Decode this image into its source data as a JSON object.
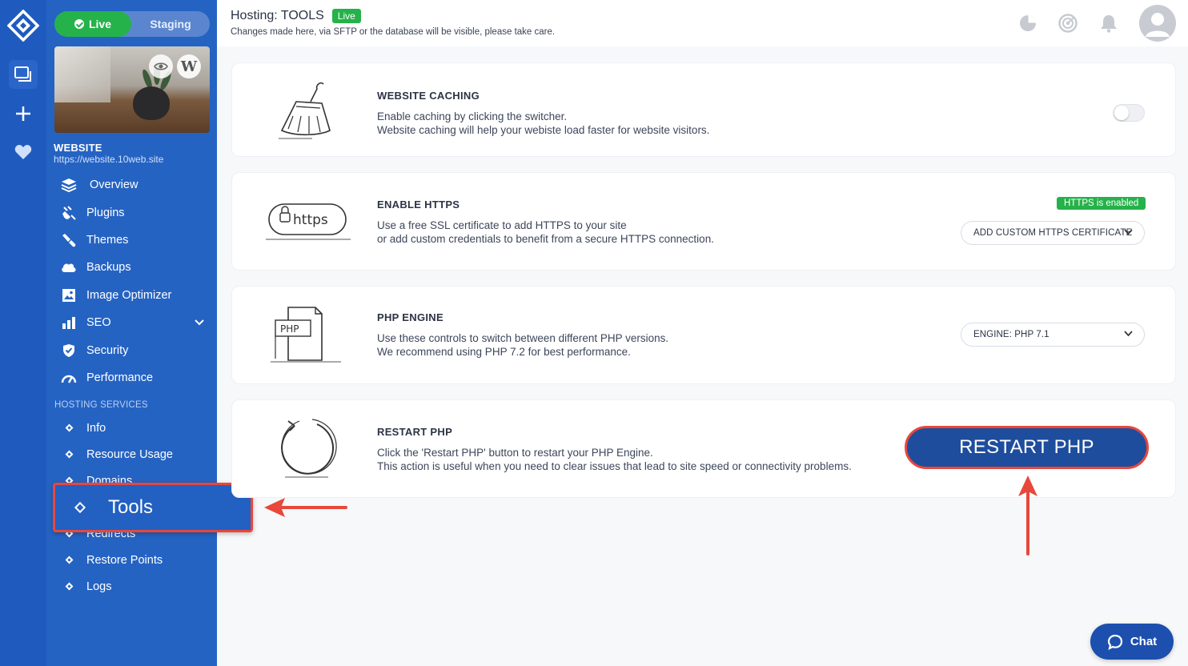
{
  "env": {
    "live_label": "Live",
    "staging_label": "Staging"
  },
  "site": {
    "name": "WEBSITE",
    "url": "https://website.10web.site",
    "wp_letter": "W"
  },
  "nav": {
    "overview": "Overview",
    "plugins": "Plugins",
    "themes": "Themes",
    "backups": "Backups",
    "image_optimizer": "Image Optimizer",
    "seo": "SEO",
    "security": "Security",
    "performance": "Performance"
  },
  "hosting": {
    "section_label": "HOSTING SERVICES",
    "info": "Info",
    "resource_usage": "Resource Usage",
    "domains": "Domains",
    "tools": "Tools",
    "redirects": "Redirects",
    "restore_points": "Restore Points",
    "logs": "Logs"
  },
  "header": {
    "title": "Hosting: TOOLS",
    "badge": "Live",
    "subtitle": "Changes made here, via SFTP or the database will be visible, please take care."
  },
  "cards": {
    "caching": {
      "title": "WEBSITE CACHING",
      "line1": "Enable caching by clicking the switcher.",
      "line2": "Website caching will help your webiste load faster for website visitors.",
      "enabled": false
    },
    "https": {
      "title": "ENABLE HTTPS",
      "line1": "Use a free SSL certificate to add HTTPS to your site",
      "line2": "or add custom credentials to benefit from a secure HTTPS connection.",
      "badge": "HTTPS is enabled",
      "dropdown": "ADD CUSTOM HTTPS CERTIFICATE",
      "illus_text": "https"
    },
    "php": {
      "title": "PHP ENGINE",
      "line1": "Use these controls to switch between different PHP versions.",
      "line2": "We recommend using PHP 7.2 for best performance.",
      "dropdown": "ENGINE: PHP 7.1",
      "illus_text": "PHP"
    },
    "restart": {
      "title": "RESTART PHP",
      "line1": "Click the 'Restart PHP' button to restart your PHP Engine.",
      "line2": "This action is useful when you need to clear issues that lead to site speed or connectivity problems.",
      "button": "RESTART PHP"
    }
  },
  "chat": {
    "label": "Chat"
  },
  "colors": {
    "rail": "#1f5bbf",
    "sidebar": "#2563c3",
    "green": "#25b24a",
    "button_blue": "#1e4d9d",
    "annotation_red": "#e8473b"
  },
  "icons": [
    "logo-icon",
    "sites-icon",
    "plus-icon",
    "heart-icon",
    "eye-icon",
    "layers-icon",
    "plug-icon",
    "brush-icon",
    "cloud-icon",
    "image-icon",
    "bar-chart-icon",
    "chevron-down-icon",
    "shield-icon",
    "gauge-icon",
    "pie-chart-icon",
    "speed-icon",
    "bell-icon",
    "user-icon",
    "chat-icon"
  ]
}
